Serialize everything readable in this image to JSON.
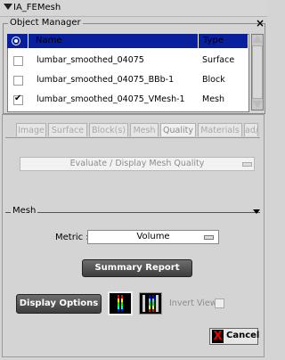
{
  "window": {
    "title": "IA_FEMesh"
  },
  "object_manager": {
    "title": "Object Manager",
    "columns": [
      "Name",
      "Type"
    ],
    "rows": [
      {
        "name": "lumbar_smoothed_04075",
        "type": "Surface",
        "checked": false
      },
      {
        "name": "lumbar_smoothed_04075_BBb-1",
        "type": "Block",
        "checked": false
      },
      {
        "name": "lumbar_smoothed_04075_VMesh-1",
        "type": "Mesh",
        "checked": true
      }
    ]
  },
  "tabs": [
    "Image",
    "Surface",
    "Block(s)",
    "Mesh",
    "Quality",
    "Materials",
    "ad/"
  ],
  "active_tab": "Quality",
  "quality": {
    "mode_select": "Evaluate / Display Mesh Quality",
    "mesh_group_label": "Mesh",
    "metric_label": "Metric :",
    "metric_value": "Volume",
    "summary_button": "Summary Report",
    "display_options_button": "Display Options",
    "invert_view_label": "Invert View",
    "invert_view_checked": false
  },
  "cancel_button": "Cancel"
}
